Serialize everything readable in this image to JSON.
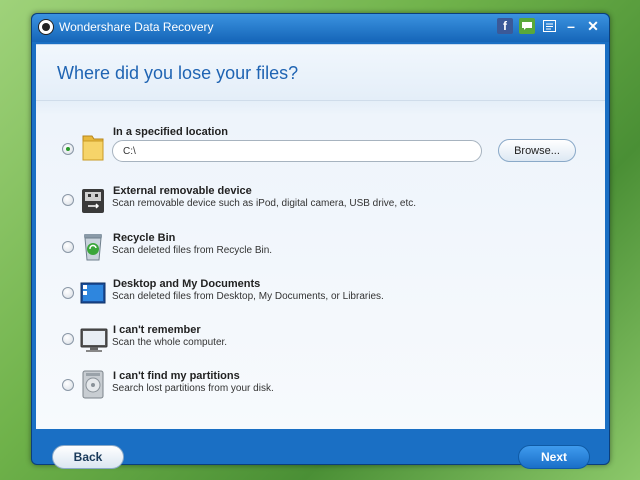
{
  "window": {
    "title": "Wondershare Data Recovery"
  },
  "header": {
    "title": "Where did you lose your files?"
  },
  "options": [
    {
      "title": "In a specified location",
      "description": "",
      "icon": "folder-icon",
      "checked": true
    },
    {
      "title": "External removable device",
      "description": "Scan removable device such as iPod, digital camera, USB drive, etc.",
      "icon": "usb-icon",
      "checked": false
    },
    {
      "title": "Recycle Bin",
      "description": "Scan deleted files from Recycle Bin.",
      "icon": "recycle-bin-icon",
      "checked": false
    },
    {
      "title": "Desktop and My Documents",
      "description": "Scan deleted files from Desktop, My Documents, or Libraries.",
      "icon": "desktop-icon",
      "checked": false
    },
    {
      "title": "I can't remember",
      "description": "Scan the whole computer.",
      "icon": "monitor-icon",
      "checked": false
    },
    {
      "title": "I can't find my partitions",
      "description": "Search lost partitions from your disk.",
      "icon": "hard-disk-icon",
      "checked": false
    }
  ],
  "location": {
    "path_value": "C:\\",
    "browse_label": "Browse..."
  },
  "footer": {
    "back_label": "Back",
    "next_label": "Next"
  },
  "colors": {
    "accent": "#1f64b3",
    "titlebar": "#1a6fc4",
    "next_button": "#1a6fc8"
  }
}
